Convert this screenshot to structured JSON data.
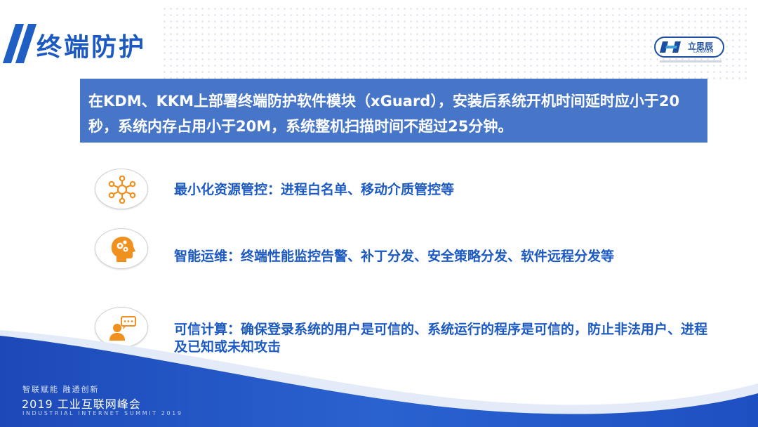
{
  "header": {
    "title": "终端防护"
  },
  "logo": {
    "name_cn": "立思辰",
    "name_en": "LANXUM"
  },
  "banner": {
    "text": "在KDM、KKM上部署终端防护软件模块（xGuard），安装后系统开机时间延时应小于20秒，系统内存占用小于20M，系统整机扫描时间不超过25分钟。"
  },
  "items": [
    {
      "icon": "network-hub-icon",
      "text": "最小化资源管控：进程白名单、移动介质管控等"
    },
    {
      "icon": "head-gears-icon",
      "text": "智能运维：终端性能监控告警、补丁分发、安全策略分发、软件远程分发等"
    },
    {
      "icon": "person-chat-icon",
      "text": "可信计算：确保登录系统的用户是可信的、系统运行的程序是可信的，防止非法用户、进程及已知或未知攻击"
    }
  ],
  "footer": {
    "slogan": "智联赋能    融通创新",
    "title": "2019 工业互联网峰会",
    "title_en": "INDUSTRIAL INTERNET SUMMIT 2019"
  },
  "colors": {
    "primary_blue": "#1c5ac2",
    "banner_blue": "#4776c8",
    "icon_orange": "#f0901e",
    "footer_blue": "#1f4fc0"
  }
}
